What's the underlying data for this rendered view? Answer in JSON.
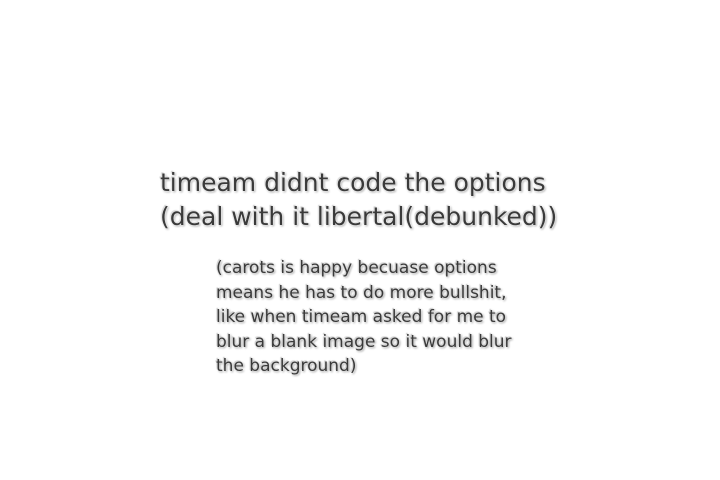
{
  "heading": {
    "lines": [
      "timeam didnt code the options",
      "(deal with it libertal(debunked))"
    ]
  },
  "note": {
    "lines": [
      "(carots is happy becuase options",
      "means he has to do more bullshit,",
      "like when timeam asked for me to",
      "blur a blank image so it would blur",
      "the background)"
    ]
  }
}
